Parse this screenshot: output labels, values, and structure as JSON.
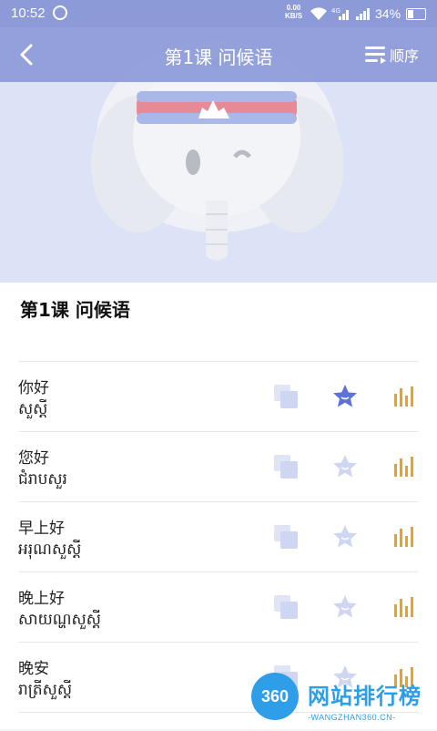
{
  "status": {
    "time": "10:52",
    "speed_value": "0.00",
    "speed_unit": "KB/S",
    "network": "4G",
    "battery": "34%"
  },
  "header": {
    "title": "第1课 问候语",
    "order_label": "顺序"
  },
  "section": {
    "title": "第1课 问候语"
  },
  "phrases": [
    {
      "zh": "你好",
      "km": "សួស្តី",
      "favorited": true
    },
    {
      "zh": "您好",
      "km": "ជំរាបសួរ",
      "favorited": false
    },
    {
      "zh": "早上好",
      "km": "អរុណសួស្តី",
      "favorited": false
    },
    {
      "zh": "晚上好",
      "km": "សាយណ្ហសួស្តី",
      "favorited": false
    },
    {
      "zh": "晚安",
      "km": "រាត្រីសួស្តី",
      "favorited": false
    }
  ],
  "watermark": {
    "logo": "360",
    "name": "网站排行榜",
    "url": "-WANGZHAN360.CN-"
  },
  "colors": {
    "primary": "#8c9ad8",
    "star_active": "#5b73d8",
    "star_inactive": "#cfd6f2",
    "copy_icon": "#cfd6f2",
    "bars": "#f0a020"
  }
}
